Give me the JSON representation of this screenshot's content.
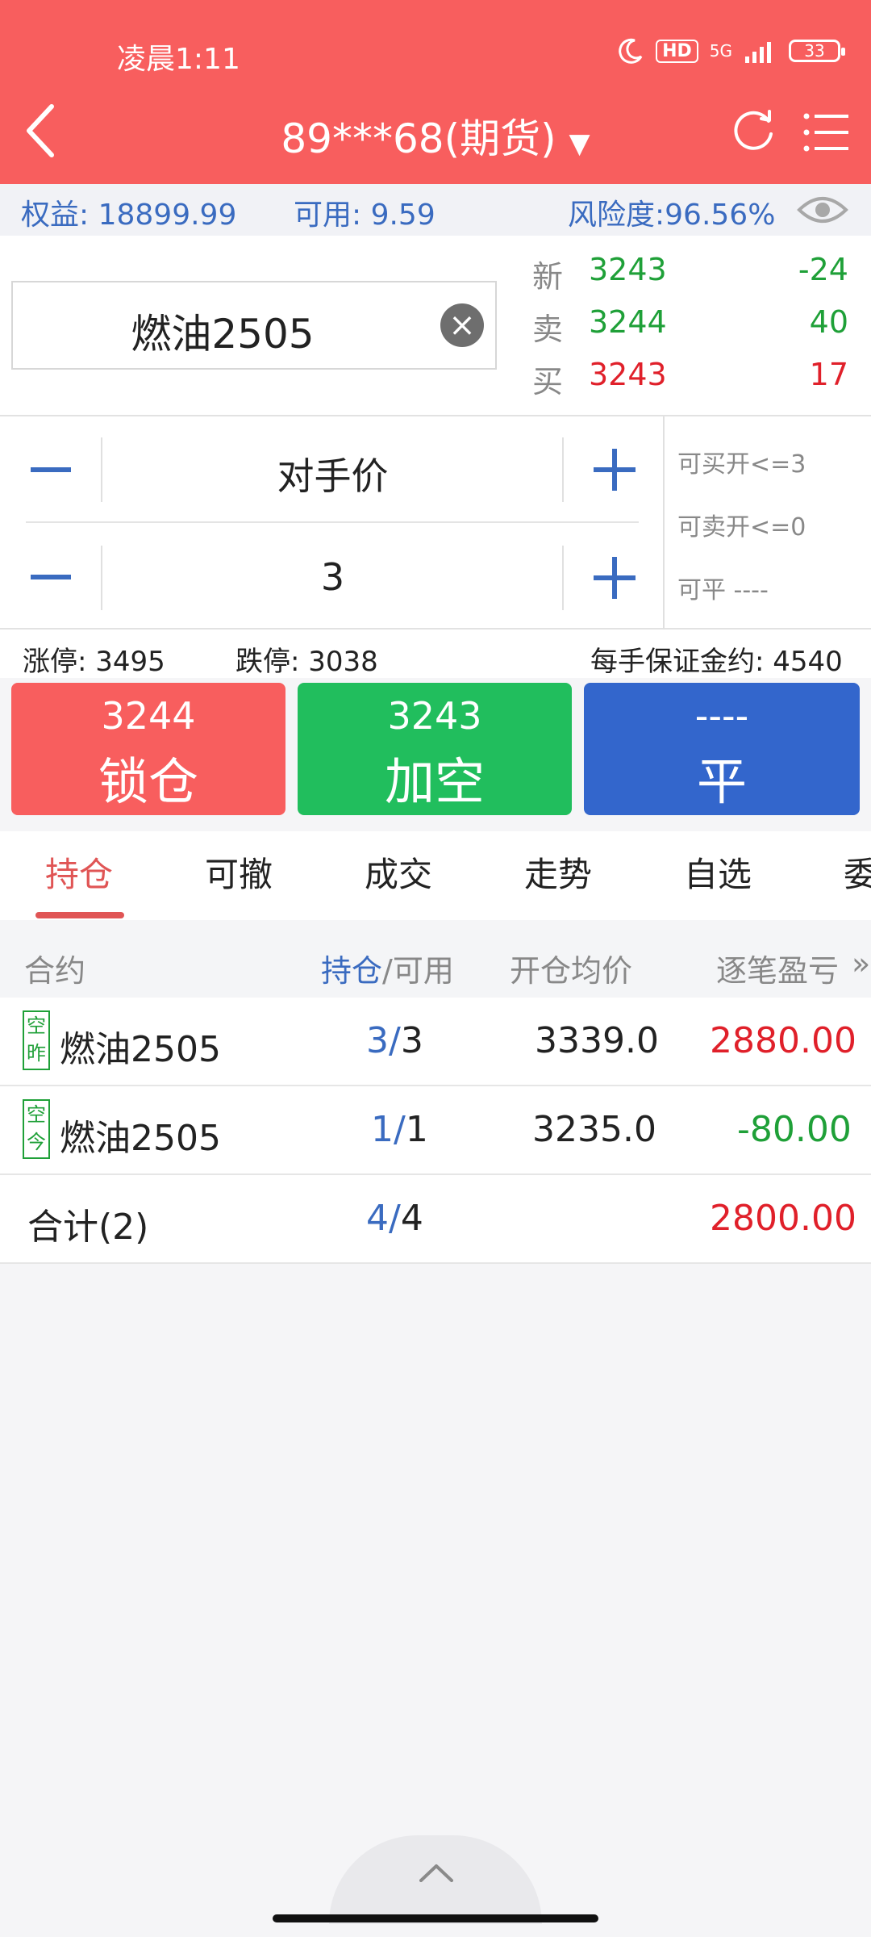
{
  "status": {
    "time": "凌晨1:11",
    "network": "5G",
    "hd": "HD",
    "battery": "33"
  },
  "header": {
    "account": "89***68(期货)",
    "dropdown": "▼"
  },
  "info": {
    "equity": "权益: 18899.99",
    "available": "可用: 9.59",
    "risk": "风险度:96.56%"
  },
  "symbol": {
    "name": "燃油2505"
  },
  "quote": [
    {
      "label": "新",
      "price": "3243",
      "vol": "-24",
      "price_color": "green",
      "vol_color": "green"
    },
    {
      "label": "卖",
      "price": "3244",
      "vol": "40",
      "price_color": "green",
      "vol_color": "green"
    },
    {
      "label": "买",
      "price": "3243",
      "vol": "17",
      "price_color": "red",
      "vol_color": "red"
    }
  ],
  "entry": {
    "price_type": "对手价",
    "quantity": "3"
  },
  "limits_side": {
    "can_buy": "可买开<=3",
    "can_sell": "可卖开<=0",
    "can_close": "可平 ----"
  },
  "limits": {
    "up": "涨停: 3495",
    "down": "跌停: 3038",
    "margin": "每手保证金约: 4540"
  },
  "actions": {
    "lock": {
      "price": "3244",
      "label": "锁仓",
      "color": "#f85e5e"
    },
    "short": {
      "price": "3243",
      "label": "加空",
      "color": "#21be5d"
    },
    "close": {
      "price": "----",
      "label": "平",
      "color": "#3366cc"
    }
  },
  "tabs": [
    "持仓",
    "可撤",
    "成交",
    "走势",
    "自选",
    "委"
  ],
  "table": {
    "headers": {
      "contract": "合约",
      "hold": "持仓",
      "avail": "/可用",
      "avg": "开仓均价",
      "pnl": "逐笔盈亏",
      "more": "»"
    },
    "rows": [
      {
        "tag": "空\n昨",
        "tag1": "空",
        "tag2": "昨",
        "name": "燃油2505",
        "hold": "3",
        "avail": "3",
        "avg": "3339.0",
        "pnl": "2880.00",
        "pnl_color": "red"
      },
      {
        "tag": "空\n今",
        "tag1": "空",
        "tag2": "今",
        "name": "燃油2505",
        "hold": "1",
        "avail": "1",
        "avg": "3235.0",
        "pnl": "-80.00",
        "pnl_color": "green"
      }
    ],
    "total": {
      "label": "合计(2)",
      "hold": "4",
      "avail": "4",
      "pnl": "2800.00"
    }
  }
}
